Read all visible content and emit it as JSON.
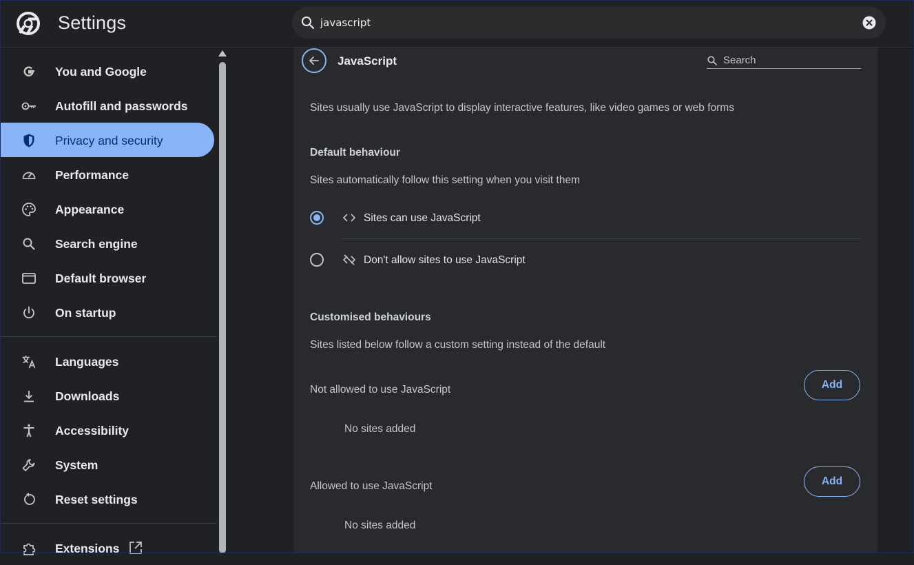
{
  "app": {
    "title": "Settings",
    "search_value": "javascript"
  },
  "sidebar": {
    "items": [
      {
        "label": "You and Google",
        "icon": "google-g-icon",
        "active": false
      },
      {
        "label": "Autofill and passwords",
        "icon": "key-icon",
        "active": false
      },
      {
        "label": "Privacy and security",
        "icon": "shield-icon",
        "active": true
      },
      {
        "label": "Performance",
        "icon": "speedometer-icon",
        "active": false
      },
      {
        "label": "Appearance",
        "icon": "palette-icon",
        "active": false
      },
      {
        "label": "Search engine",
        "icon": "search-icon",
        "active": false
      },
      {
        "label": "Default browser",
        "icon": "browser-window-icon",
        "active": false
      },
      {
        "label": "On startup",
        "icon": "power-icon",
        "active": false
      },
      {
        "label": "Languages",
        "icon": "translate-icon",
        "active": false
      },
      {
        "label": "Downloads",
        "icon": "download-icon",
        "active": false
      },
      {
        "label": "Accessibility",
        "icon": "accessibility-icon",
        "active": false
      },
      {
        "label": "System",
        "icon": "wrench-icon",
        "active": false
      },
      {
        "label": "Reset settings",
        "icon": "reset-icon",
        "active": false
      },
      {
        "label": "Extensions",
        "icon": "puzzle-icon",
        "active": false
      }
    ]
  },
  "page": {
    "title": "JavaScript",
    "search_placeholder": "Search",
    "description": "Sites usually use JavaScript to display interactive features, like video games or web forms",
    "default": {
      "heading": "Default behaviour",
      "subtext": "Sites automatically follow this setting when you visit them",
      "options": [
        {
          "label": "Sites can use JavaScript",
          "icon": "code-brackets-icon",
          "selected": true
        },
        {
          "label": "Don't allow sites to use JavaScript",
          "icon": "code-off-icon",
          "selected": false
        }
      ]
    },
    "custom": {
      "heading": "Customised behaviours",
      "subtext": "Sites listed below follow a custom setting instead of the default",
      "lists": [
        {
          "label": "Not allowed to use JavaScript",
          "button": "Add",
          "empty": "No sites added"
        },
        {
          "label": "Allowed to use JavaScript",
          "button": "Add",
          "empty": "No sites added"
        }
      ]
    }
  },
  "colors": {
    "accent": "#8ab4f8",
    "background": "#202124",
    "card": "#292a2d"
  }
}
